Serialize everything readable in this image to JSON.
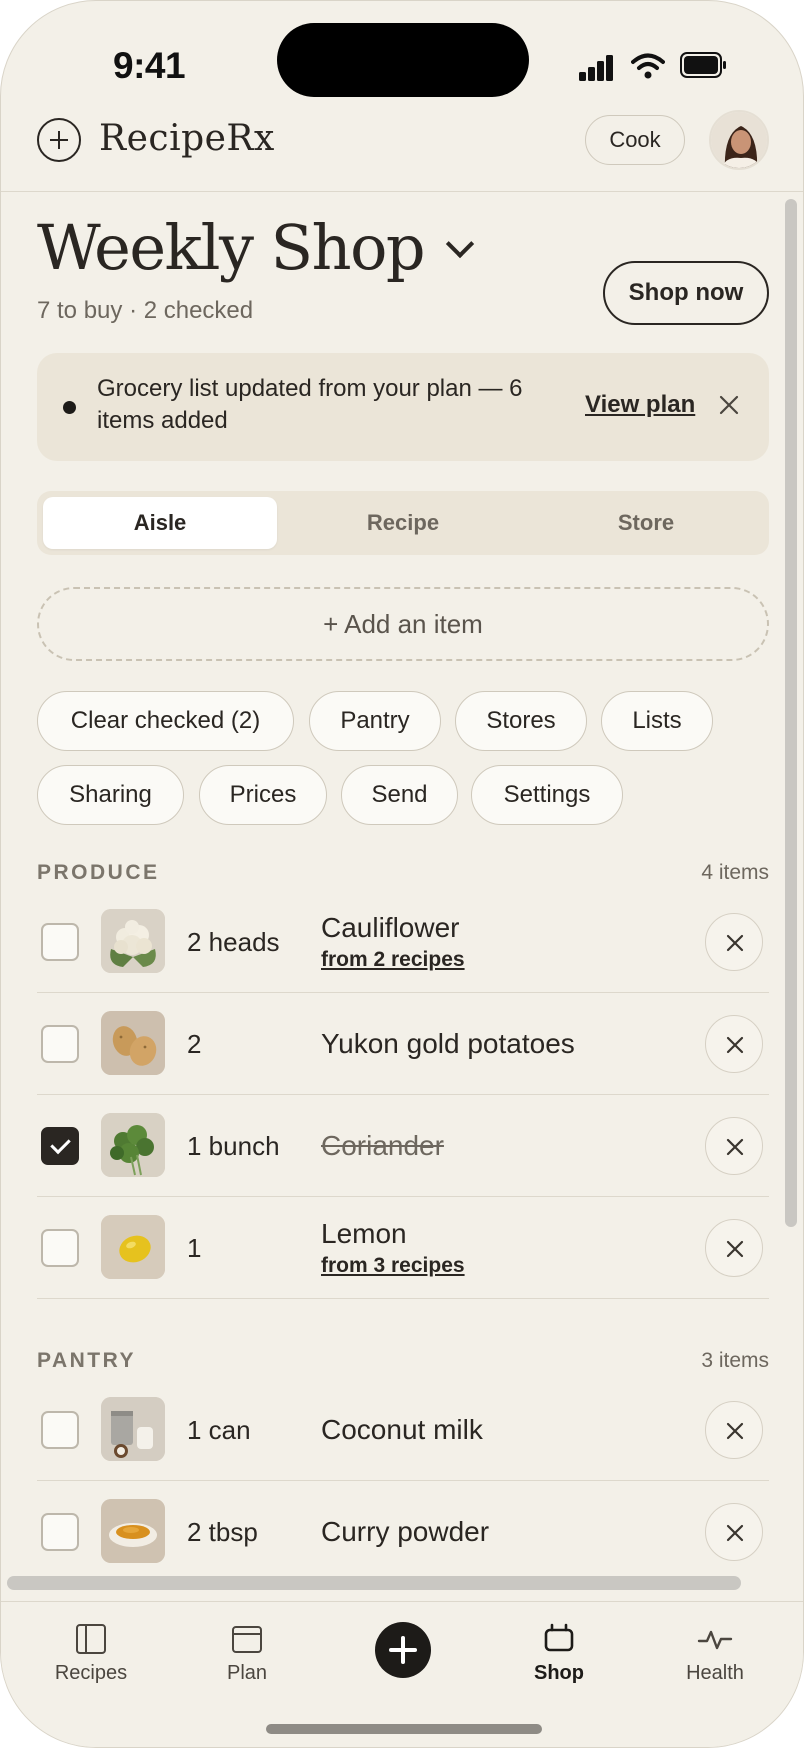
{
  "status_bar": {
    "time": "9:41"
  },
  "app": {
    "brand": "RecipeRx",
    "cook_label": "Cook"
  },
  "header": {
    "title": "Weekly Shop",
    "subtitle": "7 to buy · 2 checked",
    "shop_now_label": "Shop now"
  },
  "banner": {
    "message": "Grocery list updated from your plan — 6 items added",
    "link_label": "View plan"
  },
  "segments": {
    "tabs": [
      {
        "label": "Aisle",
        "active": true
      },
      {
        "label": "Recipe",
        "active": false
      },
      {
        "label": "Store",
        "active": false
      }
    ]
  },
  "add_item_label": "+ Add an item",
  "chips": [
    "Clear checked (2)",
    "Pantry",
    "Stores",
    "Lists",
    "Sharing",
    "Prices",
    "Send",
    "Settings"
  ],
  "sections": [
    {
      "title": "PRODUCE",
      "count": "4 items",
      "items": [
        {
          "qty": "2 heads",
          "name": "Cauliflower",
          "source": "from 2 recipes",
          "checked": false,
          "thumb": "cauliflower"
        },
        {
          "qty": "2",
          "name": "Yukon gold potatoes",
          "source": "",
          "checked": false,
          "thumb": "potatoes"
        },
        {
          "qty": "1 bunch",
          "name": "Coriander",
          "source": "",
          "checked": true,
          "thumb": "coriander"
        },
        {
          "qty": "1",
          "name": "Lemon",
          "source": "from 3 recipes",
          "checked": false,
          "thumb": "lemon"
        }
      ]
    },
    {
      "title": "PANTRY",
      "count": "3 items",
      "items": [
        {
          "qty": "1 can",
          "name": "Coconut milk",
          "source": "",
          "checked": false,
          "thumb": "coconut-milk"
        },
        {
          "qty": "2 tbsp",
          "name": "Curry powder",
          "source": "",
          "checked": false,
          "thumb": "curry-powder"
        }
      ]
    }
  ],
  "nav": {
    "items": [
      {
        "label": "Recipes",
        "icon": "sidebar-icon",
        "active": false
      },
      {
        "label": "Plan",
        "icon": "calendar-icon",
        "active": false
      },
      {
        "label": "",
        "icon": "plus-icon",
        "active": false
      },
      {
        "label": "Shop",
        "icon": "basket-icon",
        "active": true
      },
      {
        "label": "Health",
        "icon": "pulse-icon",
        "active": false
      }
    ]
  },
  "colors": {
    "background": "#f3f0e8",
    "ink": "#2a2622",
    "muted": "#6d675e",
    "banner": "#ebe5d8"
  }
}
